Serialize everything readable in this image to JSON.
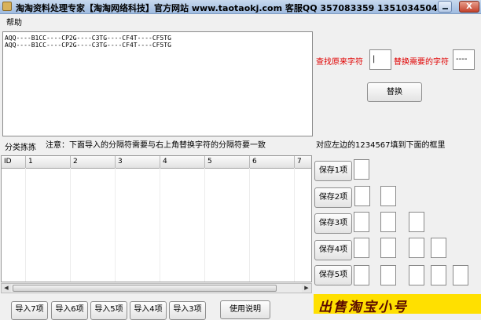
{
  "window": {
    "title": "淘淘资料处理专家【淘淘网络科技】官方网站 www.taotaokj.com 客服QQ 357083359 1351034504",
    "close_label": "X"
  },
  "menu": {
    "help": "帮助"
  },
  "source_text": "AQQ----B1CC----CP2G----C3TG----CF4T----CF5TG\nAQQ----B1CC----CP2G----C3TG----CF4T----CF5TG",
  "find_replace": {
    "find_label": "查找原来字符",
    "find_value": "|",
    "replace_label": "替换需要的字符",
    "replace_value": "----",
    "replace_button": "替换"
  },
  "split": {
    "label": "分类拣拣",
    "note": "注意：下面导入的分隔符需要与右上角替换字符的分隔符要一致"
  },
  "grid": {
    "columns": [
      "ID",
      "1",
      "2",
      "3",
      "4",
      "5",
      "6",
      "7"
    ]
  },
  "right_panel": {
    "instruction": "对应左边的1234567填到下面的框里",
    "save_buttons": [
      "保存1项",
      "保存2项",
      "保存3项",
      "保存4项",
      "保存5项"
    ]
  },
  "bottom_buttons": {
    "import_buttons": [
      "导入7项",
      "导入6项",
      "导入5项",
      "导入4项",
      "导入3项"
    ],
    "help_button": "使用说明"
  },
  "banner": {
    "text": "出售淘宝小号"
  },
  "colors": {
    "label_red": "#e00000",
    "banner_bg": "#ffe000",
    "banner_text": "#5a0a00"
  }
}
